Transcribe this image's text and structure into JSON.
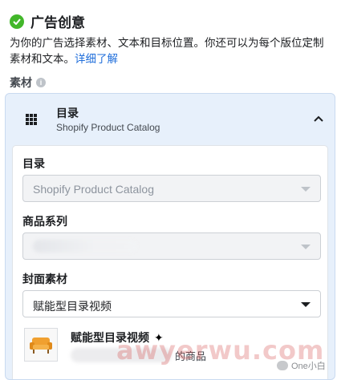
{
  "header": {
    "title": "广告创意",
    "description": "为你的广告选择素材、文本和目标位置。你还可以为每个版位定制素材和文本。",
    "link": "详细了解"
  },
  "assets": {
    "label": "素材",
    "info_icon": "i"
  },
  "catalog_panel": {
    "title": "目录",
    "subtitle": "Shopify Product Catalog",
    "expanded": true
  },
  "form": {
    "catalog_label": "目录",
    "catalog_value": "Shopify Product Catalog",
    "product_set_label": "商品系列",
    "product_set_value": "",
    "cover_label": "封面素材",
    "cover_value": "赋能型目录视频"
  },
  "preview": {
    "name": "赋能型目录视频",
    "spark_icon": "✦",
    "suffix": "的商品"
  },
  "watermark": {
    "text": "awyerwu.com",
    "badge": "One小白"
  },
  "colors": {
    "accent": "#216fdb",
    "success": "#42b72a",
    "panel_bg": "#e7f0fb"
  }
}
